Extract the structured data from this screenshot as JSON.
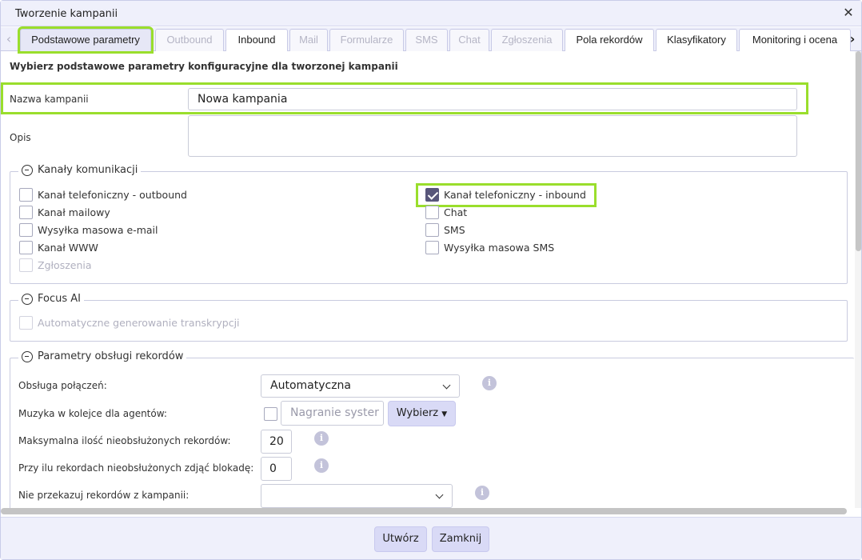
{
  "dialog": {
    "title": "Tworzenie kampanii"
  },
  "tabs": [
    {
      "label": "Podstawowe parametry",
      "state": "active"
    },
    {
      "label": "Outbound",
      "state": "disabled"
    },
    {
      "label": "Inbound",
      "state": "enabled"
    },
    {
      "label": "Mail",
      "state": "disabled"
    },
    {
      "label": "Formularze",
      "state": "disabled"
    },
    {
      "label": "SMS",
      "state": "disabled"
    },
    {
      "label": "Chat",
      "state": "disabled"
    },
    {
      "label": "Zgłoszenia",
      "state": "disabled"
    },
    {
      "label": "Pola rekordów",
      "state": "enabled"
    },
    {
      "label": "Klasyfikatory",
      "state": "enabled"
    },
    {
      "label": "Monitoring i ocena",
      "state": "enabled"
    }
  ],
  "main": {
    "heading": "Wybierz podstawowe parametry konfiguracyjne dla tworzonej kampanii",
    "name_label": "Nazwa kampanii",
    "name_value": "Nowa kampania",
    "desc_label": "Opis",
    "desc_value": ""
  },
  "channels": {
    "legend": "Kanały komunikacji",
    "left": [
      {
        "label": "Kanał telefoniczny - outbound",
        "checked": false,
        "disabled": false
      },
      {
        "label": "Kanał mailowy",
        "checked": false,
        "disabled": false
      },
      {
        "label": "Wysyłka masowa e-mail",
        "checked": false,
        "disabled": false
      },
      {
        "label": "Kanał WWW",
        "checked": false,
        "disabled": false
      },
      {
        "label": "Zgłoszenia",
        "checked": false,
        "disabled": true
      }
    ],
    "right": [
      {
        "label": "Kanał telefoniczny - inbound",
        "checked": true,
        "disabled": false
      },
      {
        "label": "Chat",
        "checked": false,
        "disabled": false
      },
      {
        "label": "SMS",
        "checked": false,
        "disabled": false
      },
      {
        "label": "Wysyłka masowa SMS",
        "checked": false,
        "disabled": false
      }
    ]
  },
  "focus_ai": {
    "legend": "Focus AI",
    "option": "Automatyczne generowanie transkrypcji"
  },
  "records": {
    "legend": "Parametry obsługi rekordów",
    "handling_label": "Obsługa połączeń:",
    "handling_value": "Automatyczna",
    "music_label": "Muzyka w kolejce dla agentów:",
    "music_placeholder": "Nagranie syster",
    "choose_button": "Wybierz",
    "max_label": "Maksymalna ilość nieobsłużonych rekordów:",
    "max_value": "20",
    "unlock_label": "Przy ilu rekordach nieobsłużonych zdjąć blokadę:",
    "unlock_value": "0",
    "no_pass_label": "Nie przekazuj rekordów z kampanii:",
    "no_pass_value": "",
    "info_glyph": "i"
  },
  "footer": {
    "create": "Utwórz",
    "close": "Zamknij"
  },
  "colors": {
    "highlight": "#9ade2c",
    "header_bg": "#eff0fb",
    "button_bg": "#d9daf6",
    "checkbox_checked": "#58567a"
  }
}
